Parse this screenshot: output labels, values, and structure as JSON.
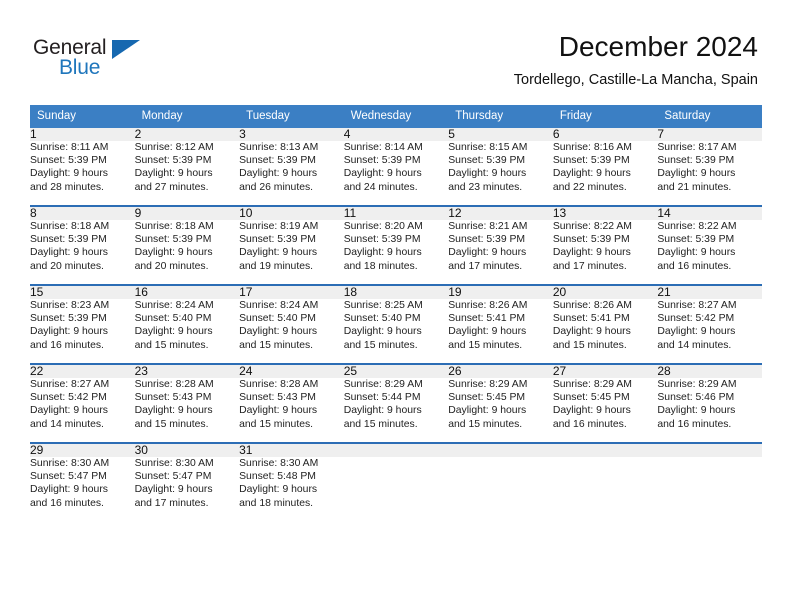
{
  "brand": {
    "name_top": "General",
    "name_bottom": "Blue",
    "triangle_color": "#1668b0",
    "text_color": "#231f20",
    "blue_color": "#1f76bc"
  },
  "header": {
    "title": "December 2024",
    "subtitle": "Tordellego, Castille-La Mancha, Spain"
  },
  "theme": {
    "header_bg": "#3b7fc4",
    "row_rule": "#2c6db5",
    "daynum_bg": "#efefef"
  },
  "calendar": {
    "weekday_headers": [
      "Sunday",
      "Monday",
      "Tuesday",
      "Wednesday",
      "Thursday",
      "Friday",
      "Saturday"
    ],
    "weeks": [
      [
        {
          "day": "1",
          "sunrise": "Sunrise: 8:11 AM",
          "sunset": "Sunset: 5:39 PM",
          "daylight1": "Daylight: 9 hours",
          "daylight2": "and 28 minutes."
        },
        {
          "day": "2",
          "sunrise": "Sunrise: 8:12 AM",
          "sunset": "Sunset: 5:39 PM",
          "daylight1": "Daylight: 9 hours",
          "daylight2": "and 27 minutes."
        },
        {
          "day": "3",
          "sunrise": "Sunrise: 8:13 AM",
          "sunset": "Sunset: 5:39 PM",
          "daylight1": "Daylight: 9 hours",
          "daylight2": "and 26 minutes."
        },
        {
          "day": "4",
          "sunrise": "Sunrise: 8:14 AM",
          "sunset": "Sunset: 5:39 PM",
          "daylight1": "Daylight: 9 hours",
          "daylight2": "and 24 minutes."
        },
        {
          "day": "5",
          "sunrise": "Sunrise: 8:15 AM",
          "sunset": "Sunset: 5:39 PM",
          "daylight1": "Daylight: 9 hours",
          "daylight2": "and 23 minutes."
        },
        {
          "day": "6",
          "sunrise": "Sunrise: 8:16 AM",
          "sunset": "Sunset: 5:39 PM",
          "daylight1": "Daylight: 9 hours",
          "daylight2": "and 22 minutes."
        },
        {
          "day": "7",
          "sunrise": "Sunrise: 8:17 AM",
          "sunset": "Sunset: 5:39 PM",
          "daylight1": "Daylight: 9 hours",
          "daylight2": "and 21 minutes."
        }
      ],
      [
        {
          "day": "8",
          "sunrise": "Sunrise: 8:18 AM",
          "sunset": "Sunset: 5:39 PM",
          "daylight1": "Daylight: 9 hours",
          "daylight2": "and 20 minutes."
        },
        {
          "day": "9",
          "sunrise": "Sunrise: 8:18 AM",
          "sunset": "Sunset: 5:39 PM",
          "daylight1": "Daylight: 9 hours",
          "daylight2": "and 20 minutes."
        },
        {
          "day": "10",
          "sunrise": "Sunrise: 8:19 AM",
          "sunset": "Sunset: 5:39 PM",
          "daylight1": "Daylight: 9 hours",
          "daylight2": "and 19 minutes."
        },
        {
          "day": "11",
          "sunrise": "Sunrise: 8:20 AM",
          "sunset": "Sunset: 5:39 PM",
          "daylight1": "Daylight: 9 hours",
          "daylight2": "and 18 minutes."
        },
        {
          "day": "12",
          "sunrise": "Sunrise: 8:21 AM",
          "sunset": "Sunset: 5:39 PM",
          "daylight1": "Daylight: 9 hours",
          "daylight2": "and 17 minutes."
        },
        {
          "day": "13",
          "sunrise": "Sunrise: 8:22 AM",
          "sunset": "Sunset: 5:39 PM",
          "daylight1": "Daylight: 9 hours",
          "daylight2": "and 17 minutes."
        },
        {
          "day": "14",
          "sunrise": "Sunrise: 8:22 AM",
          "sunset": "Sunset: 5:39 PM",
          "daylight1": "Daylight: 9 hours",
          "daylight2": "and 16 minutes."
        }
      ],
      [
        {
          "day": "15",
          "sunrise": "Sunrise: 8:23 AM",
          "sunset": "Sunset: 5:39 PM",
          "daylight1": "Daylight: 9 hours",
          "daylight2": "and 16 minutes."
        },
        {
          "day": "16",
          "sunrise": "Sunrise: 8:24 AM",
          "sunset": "Sunset: 5:40 PM",
          "daylight1": "Daylight: 9 hours",
          "daylight2": "and 15 minutes."
        },
        {
          "day": "17",
          "sunrise": "Sunrise: 8:24 AM",
          "sunset": "Sunset: 5:40 PM",
          "daylight1": "Daylight: 9 hours",
          "daylight2": "and 15 minutes."
        },
        {
          "day": "18",
          "sunrise": "Sunrise: 8:25 AM",
          "sunset": "Sunset: 5:40 PM",
          "daylight1": "Daylight: 9 hours",
          "daylight2": "and 15 minutes."
        },
        {
          "day": "19",
          "sunrise": "Sunrise: 8:26 AM",
          "sunset": "Sunset: 5:41 PM",
          "daylight1": "Daylight: 9 hours",
          "daylight2": "and 15 minutes."
        },
        {
          "day": "20",
          "sunrise": "Sunrise: 8:26 AM",
          "sunset": "Sunset: 5:41 PM",
          "daylight1": "Daylight: 9 hours",
          "daylight2": "and 15 minutes."
        },
        {
          "day": "21",
          "sunrise": "Sunrise: 8:27 AM",
          "sunset": "Sunset: 5:42 PM",
          "daylight1": "Daylight: 9 hours",
          "daylight2": "and 14 minutes."
        }
      ],
      [
        {
          "day": "22",
          "sunrise": "Sunrise: 8:27 AM",
          "sunset": "Sunset: 5:42 PM",
          "daylight1": "Daylight: 9 hours",
          "daylight2": "and 14 minutes."
        },
        {
          "day": "23",
          "sunrise": "Sunrise: 8:28 AM",
          "sunset": "Sunset: 5:43 PM",
          "daylight1": "Daylight: 9 hours",
          "daylight2": "and 15 minutes."
        },
        {
          "day": "24",
          "sunrise": "Sunrise: 8:28 AM",
          "sunset": "Sunset: 5:43 PM",
          "daylight1": "Daylight: 9 hours",
          "daylight2": "and 15 minutes."
        },
        {
          "day": "25",
          "sunrise": "Sunrise: 8:29 AM",
          "sunset": "Sunset: 5:44 PM",
          "daylight1": "Daylight: 9 hours",
          "daylight2": "and 15 minutes."
        },
        {
          "day": "26",
          "sunrise": "Sunrise: 8:29 AM",
          "sunset": "Sunset: 5:45 PM",
          "daylight1": "Daylight: 9 hours",
          "daylight2": "and 15 minutes."
        },
        {
          "day": "27",
          "sunrise": "Sunrise: 8:29 AM",
          "sunset": "Sunset: 5:45 PM",
          "daylight1": "Daylight: 9 hours",
          "daylight2": "and 16 minutes."
        },
        {
          "day": "28",
          "sunrise": "Sunrise: 8:29 AM",
          "sunset": "Sunset: 5:46 PM",
          "daylight1": "Daylight: 9 hours",
          "daylight2": "and 16 minutes."
        }
      ],
      [
        {
          "day": "29",
          "sunrise": "Sunrise: 8:30 AM",
          "sunset": "Sunset: 5:47 PM",
          "daylight1": "Daylight: 9 hours",
          "daylight2": "and 16 minutes."
        },
        {
          "day": "30",
          "sunrise": "Sunrise: 8:30 AM",
          "sunset": "Sunset: 5:47 PM",
          "daylight1": "Daylight: 9 hours",
          "daylight2": "and 17 minutes."
        },
        {
          "day": "31",
          "sunrise": "Sunrise: 8:30 AM",
          "sunset": "Sunset: 5:48 PM",
          "daylight1": "Daylight: 9 hours",
          "daylight2": "and 18 minutes."
        },
        {
          "day": "",
          "sunrise": "",
          "sunset": "",
          "daylight1": "",
          "daylight2": ""
        },
        {
          "day": "",
          "sunrise": "",
          "sunset": "",
          "daylight1": "",
          "daylight2": ""
        },
        {
          "day": "",
          "sunrise": "",
          "sunset": "",
          "daylight1": "",
          "daylight2": ""
        },
        {
          "day": "",
          "sunrise": "",
          "sunset": "",
          "daylight1": "",
          "daylight2": ""
        }
      ]
    ]
  }
}
